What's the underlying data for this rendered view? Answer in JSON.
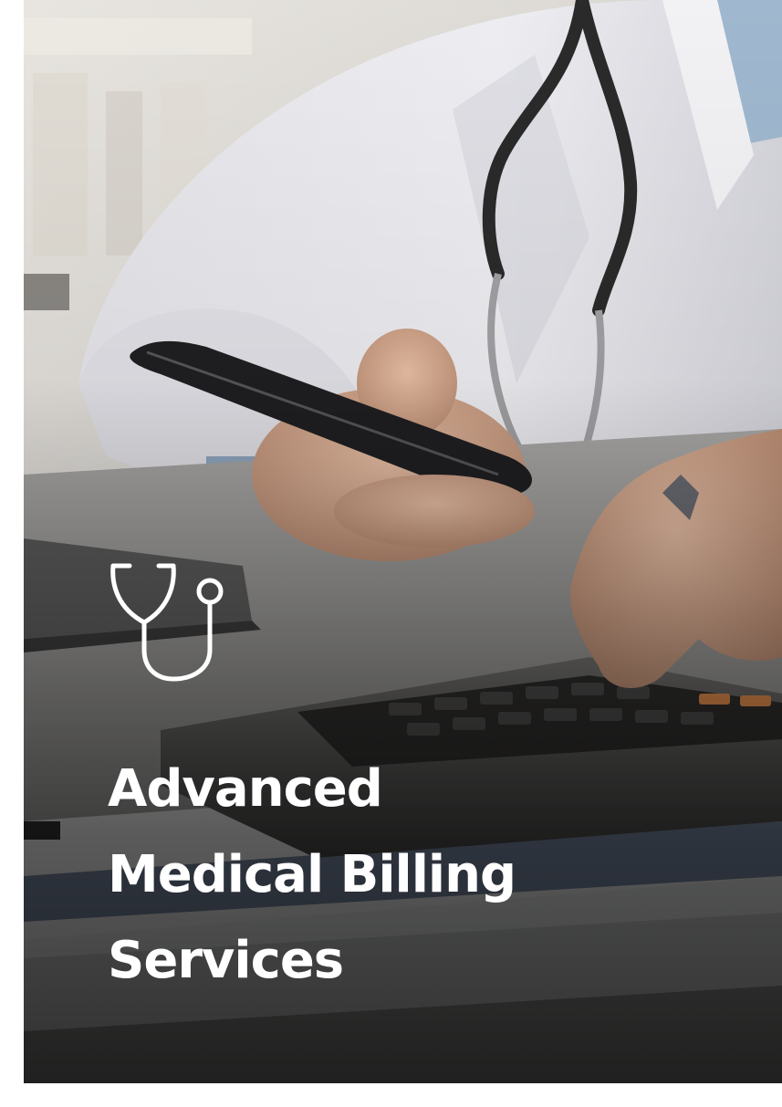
{
  "hero": {
    "title_lines": [
      "Advanced",
      "Medical Billing",
      "Services"
    ],
    "icon": "stethoscope-icon",
    "text_color": "#ffffff"
  }
}
